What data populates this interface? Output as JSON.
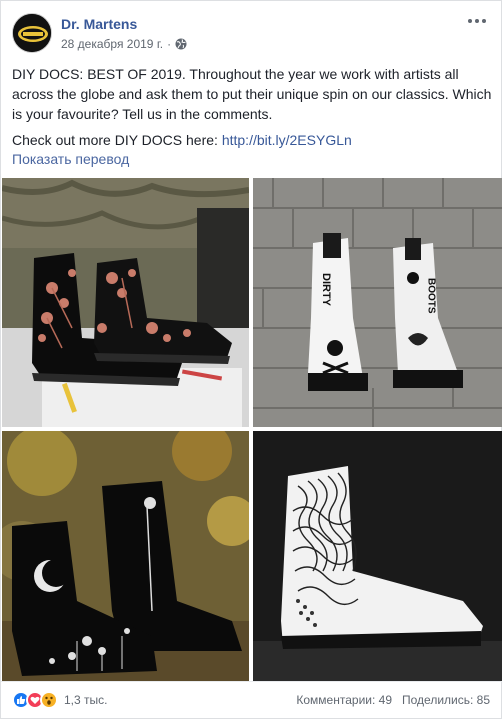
{
  "post": {
    "page_name": "Dr. Martens",
    "avatar_text": "Dr. Martens",
    "date": "28 декабря 2019 г.",
    "separator": "·",
    "text_line1": "DIY DOCS: BEST OF 2019. Throughout the year we work with artists all across the globe and ask them to put their unique spin on our classics. Which is your favourite? Tell us in the comments.",
    "text_line2_prefix": "Check out more DIY DOCS here: ",
    "link": "http://bit.ly/2ESYGLn",
    "translate": "Показать перевод"
  },
  "photos": [
    {
      "name": "photo-floral-boots"
    },
    {
      "name": "photo-dirty-boots"
    },
    {
      "name": "photo-moon-boots"
    },
    {
      "name": "photo-wave-boot",
      "texts": []
    }
  ],
  "boot_texts": {
    "dirty": "DIRTY",
    "boots": "BOOTS"
  },
  "footer": {
    "reactions": [
      "like-icon",
      "love-icon",
      "wow-icon"
    ],
    "reaction_count": "1,3 тыс.",
    "comments": "Комментарии: 49",
    "shares": "Поделились: 85"
  },
  "colors": {
    "link": "#385898",
    "like": "#1877f2",
    "love": "#f33e58",
    "wow": "#f7b125"
  }
}
